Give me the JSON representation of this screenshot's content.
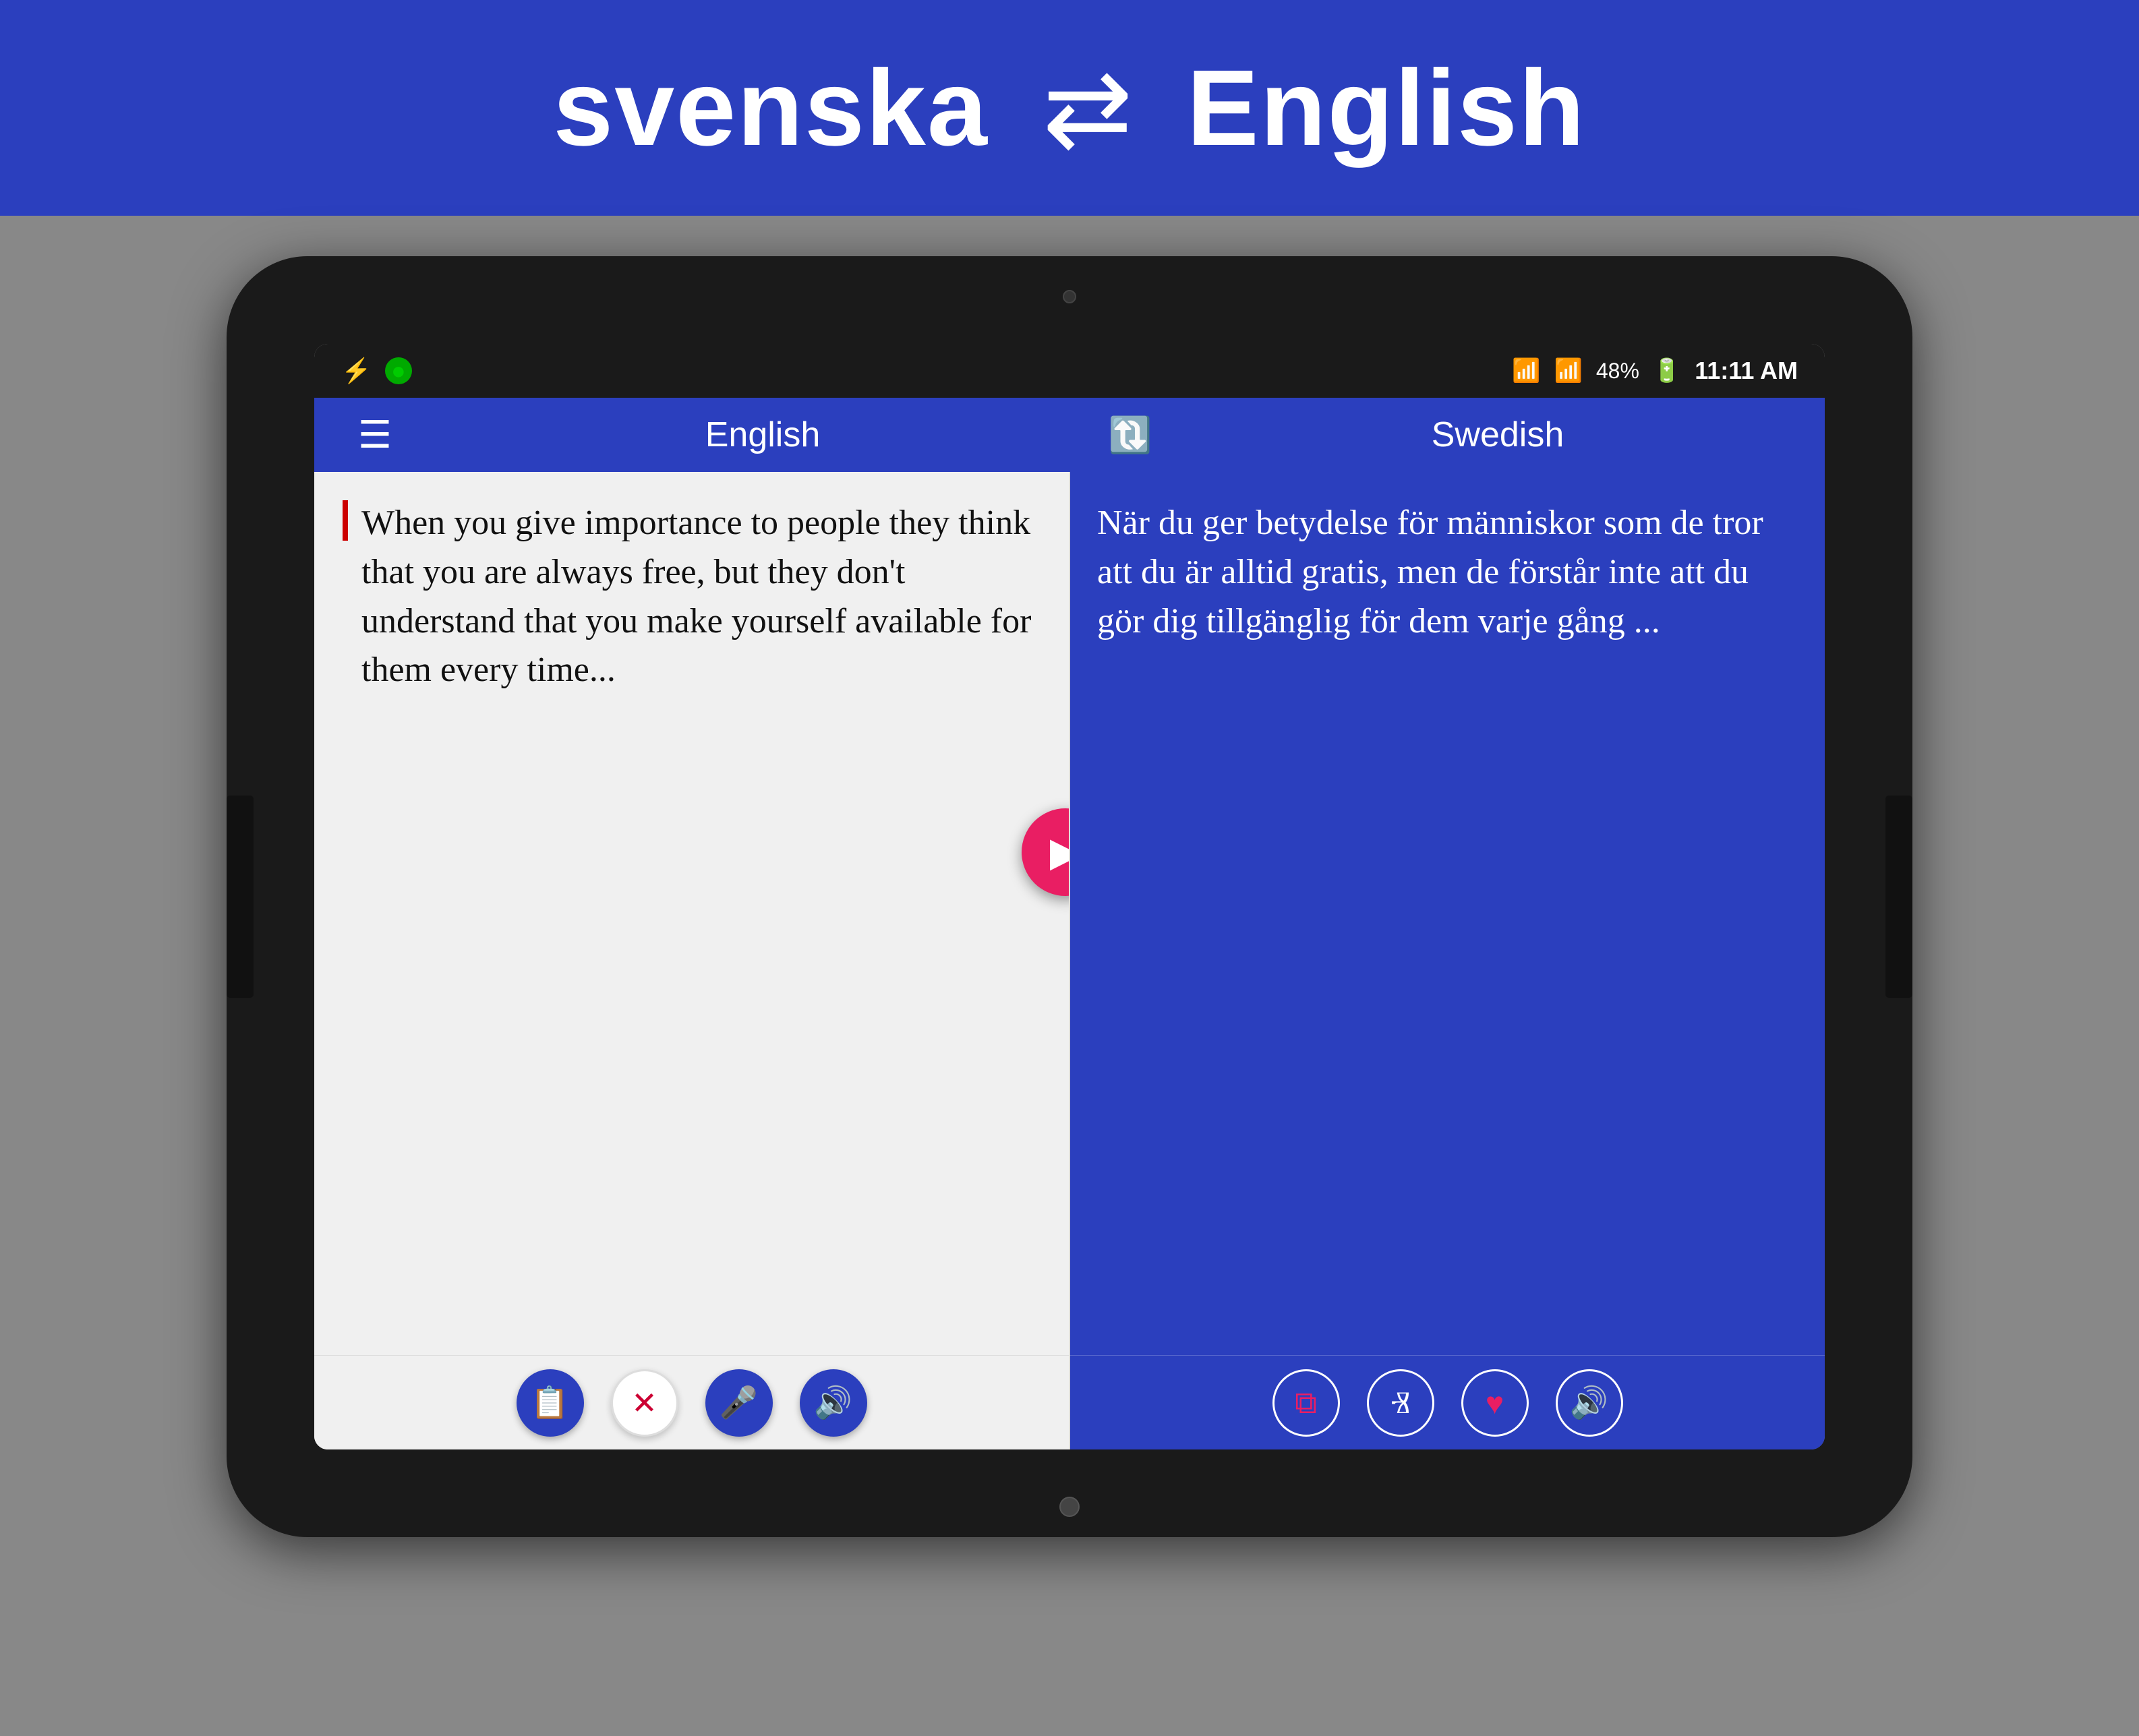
{
  "banner": {
    "lang1": "svenska",
    "lang2": "English",
    "swap_icon": "⇄"
  },
  "status_bar": {
    "time": "11:11 AM",
    "battery": "48%",
    "usb_icon": "⚡",
    "wifi_icon": "wifi",
    "signal_icon": "signal"
  },
  "toolbar": {
    "lang1_label": "English",
    "lang2_label": "Swedish",
    "swap_icon": "swap"
  },
  "left_panel": {
    "text": "When you give importance to people they think that you are always free, but they don't understand that you make yourself available for them every time...",
    "btn_clipboard": "clipboard",
    "btn_clear": "×",
    "btn_mic": "mic",
    "btn_speaker": "speaker"
  },
  "right_panel": {
    "text": "När du ger betydelse för människor som de tror att du är alltid gratis, men de förstår inte att du gör dig tillgänglig för dem varje gång ...",
    "btn_copy": "copy",
    "btn_share": "share",
    "btn_fav": "heart",
    "btn_speaker": "speaker"
  },
  "translate_btn_icon": "▶"
}
